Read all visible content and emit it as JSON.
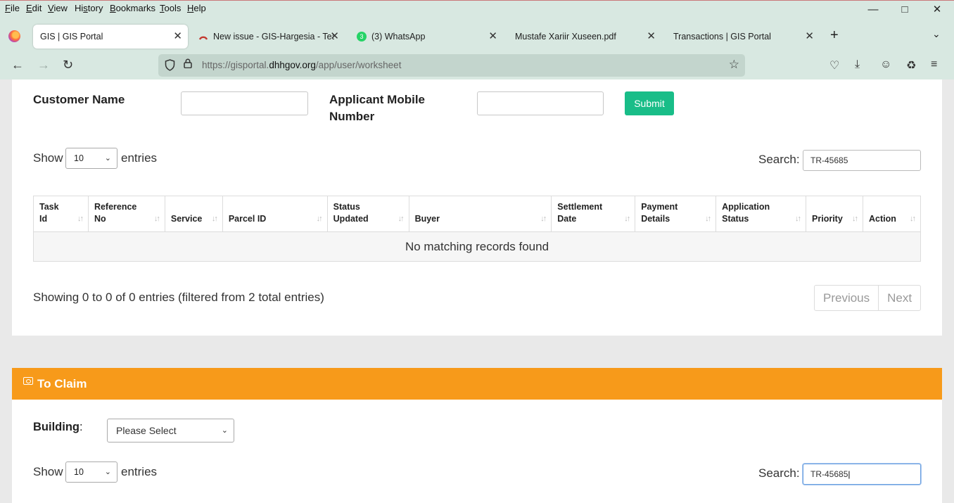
{
  "menu": [
    "File",
    "Edit",
    "View",
    "History",
    "Bookmarks",
    "Tools",
    "Help"
  ],
  "menu_mnemonic": [
    "F",
    "E",
    "V",
    "s",
    "B",
    "T",
    "H"
  ],
  "tabs": [
    {
      "title": "GIS | GIS Portal"
    },
    {
      "title": "New issue - GIS-Hargesia - Team"
    },
    {
      "title": "(3) WhatsApp",
      "badge": "3"
    },
    {
      "title": "Mustafe Xariir Xuseen.pdf"
    },
    {
      "title": "Transactions | GIS Portal"
    }
  ],
  "url": {
    "prefix": "https://gisportal.",
    "domain": "dhhgov.org",
    "path": "/app/user/worksheet"
  },
  "filter": {
    "customer_name_label": "Customer Name",
    "customer_name_value": "",
    "mobile_label_line1": "Applicant Mobile",
    "mobile_label_line2": "Number",
    "mobile_value": "",
    "submit_label": "Submit"
  },
  "table1": {
    "show_label": "Show",
    "entries_label": "entries",
    "length_value": "10",
    "search_label": "Search:",
    "search_value": "TR-45685",
    "columns": [
      {
        "line1": "Task",
        "line2": "Id"
      },
      {
        "line1": "Reference",
        "line2": "No"
      },
      {
        "line1": "",
        "line2": "Service"
      },
      {
        "line1": "",
        "line2": "Parcel ID"
      },
      {
        "line1": "Status",
        "line2": "Updated"
      },
      {
        "line1": "",
        "line2": "Buyer"
      },
      {
        "line1": "Settlement",
        "line2": "Date"
      },
      {
        "line1": "Payment",
        "line2": "Details"
      },
      {
        "line1": "Application",
        "line2": "Status"
      },
      {
        "line1": "",
        "line2": "Priority"
      },
      {
        "line1": "",
        "line2": "Action"
      }
    ],
    "empty_message": "No matching records found",
    "info": "Showing 0 to 0 of 0 entries (filtered from 2 total entries)",
    "prev_label": "Previous",
    "next_label": "Next"
  },
  "claim": {
    "title": "To Claim",
    "building_label": "Building",
    "building_colon": ":",
    "building_value": "Please Select",
    "show_label": "Show",
    "entries_label": "entries",
    "length_value": "10",
    "search_label": "Search:",
    "search_value": "TR-45685"
  },
  "colors": {
    "accent_green": "#19bd88",
    "claim_header": "#f79a1a",
    "chrome": "#d8e8e1"
  }
}
